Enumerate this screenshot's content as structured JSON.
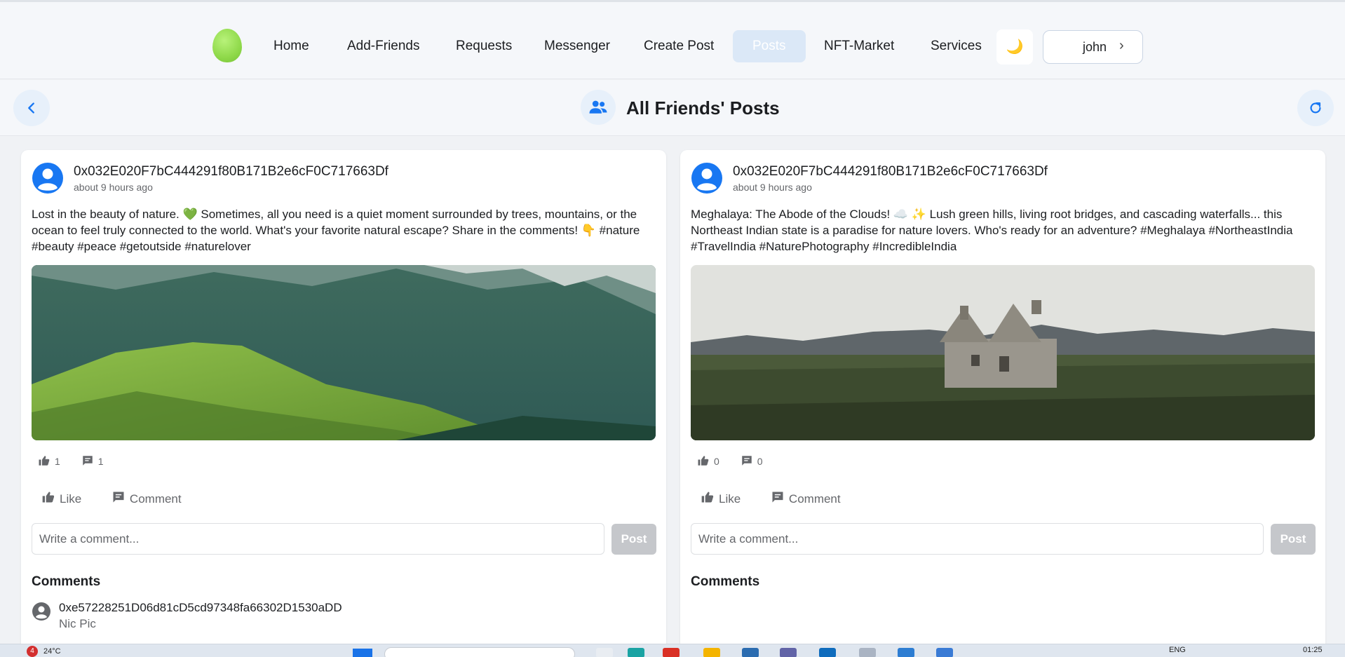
{
  "nav": {
    "items": [
      {
        "label": "Home"
      },
      {
        "label": "Add-Friends"
      },
      {
        "label": "Requests"
      },
      {
        "label": "Messenger"
      },
      {
        "label": "Create Post"
      },
      {
        "label": "Posts"
      },
      {
        "label": "NFT-Market"
      },
      {
        "label": "Services"
      }
    ],
    "active": "Posts",
    "theme_icon": "🌙",
    "user_name": "john",
    "user_chevron": "›"
  },
  "header": {
    "title": "All Friends' Posts",
    "back_icon": "chevron-left-icon",
    "refresh_icon": "refresh-icon",
    "title_icon": "people-icon"
  },
  "posts": [
    {
      "author": "0x032E020F7bC444291f80B171B2e6cF0C717663Df",
      "time": "about 9 hours ago",
      "text": "Lost in the beauty of nature. 💚 Sometimes, all you need is a quiet moment surrounded by trees, mountains, or the ocean to feel truly connected to the world. What's your favorite natural escape? Share in the comments! 👇 #nature #beauty #peace #getoutside #naturelover",
      "likes": "1",
      "comments_count": "1",
      "like_label": "Like",
      "comment_label": "Comment",
      "comment_placeholder": "Write a comment...",
      "post_button": "Post",
      "comments_title": "Comments",
      "comments": [
        {
          "author": "0xe57228251D06d81cD5cd97348fa66302D1530aDD",
          "text": "Nic Pic"
        }
      ]
    },
    {
      "author": "0x032E020F7bC444291f80B171B2e6cF0C717663Df",
      "time": "about 9 hours ago",
      "text": "Meghalaya: The Abode of the Clouds! ☁️ ✨ Lush green hills, living root bridges, and cascading waterfalls... this Northeast Indian state is a paradise for nature lovers. Who's ready for an adventure? #Meghalaya #NortheastIndia #TravelIndia #NaturePhotography #IncredibleIndia",
      "likes": "0",
      "comments_count": "0",
      "like_label": "Like",
      "comment_label": "Comment",
      "comment_placeholder": "Write a comment...",
      "post_button": "Post",
      "comments_title": "Comments",
      "comments": []
    }
  ],
  "taskbar": {
    "notification_count": "4",
    "temperature": "24°C",
    "language": "ENG",
    "clock": "01:25"
  },
  "colors": {
    "accent": "#1877f2",
    "nav_active_bg": "#dbe8f7",
    "post_button_disabled": "#c5c7cb"
  }
}
